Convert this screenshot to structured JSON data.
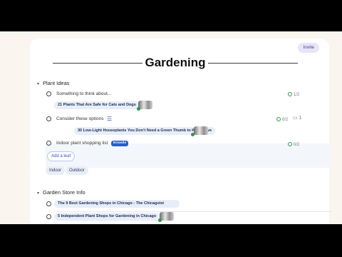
{
  "header": {
    "title": "Gardening",
    "invite_label": "Invite"
  },
  "sections": [
    {
      "label": "Plant Ideas",
      "items": [
        {
          "text": "Something to think about...",
          "progress": "1/2",
          "chip": "21 Plants That Are Safe for Cats and Dogs"
        },
        {
          "text": "Consider these options",
          "progress": "0/2",
          "comments": "1",
          "chip": "30 Low-Light Houseplants You Don't Need a Green Thumb to Keep Alive"
        },
        {
          "text": "Indoor plant shopping list",
          "tag": "Errands",
          "progress": "0/2"
        }
      ],
      "add_leaf_label": "Add a leaf",
      "tags": [
        "Indoor",
        "Outdoor"
      ]
    },
    {
      "label": "Garden Store Info",
      "items": [
        {
          "chip": "The 9 Best Gardening Shops in Chicago - The Chicagoist"
        },
        {
          "chip": "5 Independent Plant Shops for Gardening in Chicago"
        }
      ]
    }
  ],
  "colors": {
    "accent": "#2f55c4",
    "check": "#2e9a44",
    "invite_bg": "#e9e5f7"
  }
}
